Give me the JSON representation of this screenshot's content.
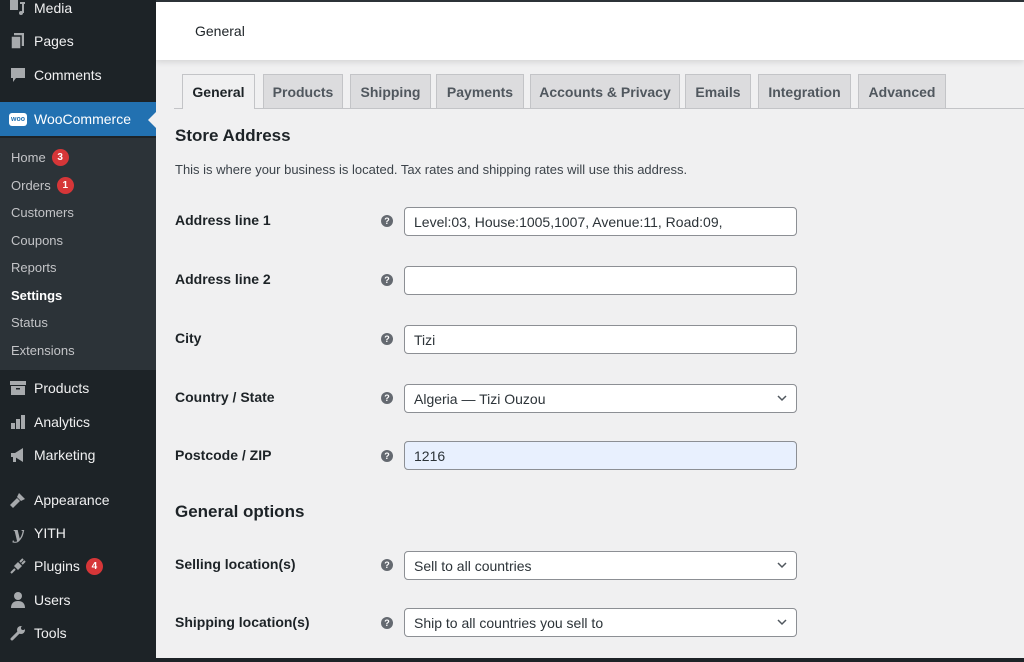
{
  "sidebar": {
    "top_items": [
      {
        "label": "Media",
        "icon": "media-icon"
      },
      {
        "label": "Pages",
        "icon": "pages-icon"
      },
      {
        "label": "Comments",
        "icon": "comments-icon"
      }
    ],
    "woocommerce": {
      "label": "WooCommerce",
      "icon": "woo-icon",
      "icon_text": "woo"
    },
    "submenu": [
      {
        "label": "Home",
        "badge": "3"
      },
      {
        "label": "Orders",
        "badge": "1"
      },
      {
        "label": "Customers"
      },
      {
        "label": "Coupons"
      },
      {
        "label": "Reports"
      },
      {
        "label": "Settings",
        "current": true
      },
      {
        "label": "Status"
      },
      {
        "label": "Extensions"
      }
    ],
    "bottom_items": [
      {
        "label": "Products",
        "icon": "archive-icon"
      },
      {
        "label": "Analytics",
        "icon": "bar-chart-icon"
      },
      {
        "label": "Marketing",
        "icon": "megaphone-icon"
      },
      {
        "label": "Appearance",
        "icon": "paintbrush-icon"
      },
      {
        "label": "YITH",
        "icon": "yith-icon",
        "icon_text": "y"
      },
      {
        "label": "Plugins",
        "icon": "plug-icon",
        "badge": "4"
      },
      {
        "label": "Users",
        "icon": "user-icon"
      },
      {
        "label": "Tools",
        "icon": "wrench-icon"
      }
    ],
    "colors": {
      "background": "#1d2327",
      "submenu_bg": "#2c3338",
      "active": "#2271b1",
      "badge": "#d63638"
    }
  },
  "header": {
    "title": "General"
  },
  "tabs": [
    {
      "label": "General",
      "active": true
    },
    {
      "label": "Products"
    },
    {
      "label": "Shipping"
    },
    {
      "label": "Payments"
    },
    {
      "label": "Accounts & Privacy"
    },
    {
      "label": "Emails"
    },
    {
      "label": "Integration"
    },
    {
      "label": "Advanced"
    }
  ],
  "store_address": {
    "heading": "Store Address",
    "description": "This is where your business is located. Tax rates and shipping rates will use this address.",
    "fields": [
      {
        "label": "Address line 1",
        "value": "Level:03, House:1005,1007, Avenue:11, Road:09,",
        "type": "text"
      },
      {
        "label": "Address line 2",
        "value": "",
        "type": "text"
      },
      {
        "label": "City",
        "value": "Tizi",
        "type": "text"
      },
      {
        "label": "Country / State",
        "value": "Algeria — Tizi Ouzou",
        "type": "select"
      },
      {
        "label": "Postcode / ZIP",
        "value": "1216",
        "type": "text",
        "focused": true
      }
    ]
  },
  "general_options": {
    "heading": "General options",
    "fields": [
      {
        "label": "Selling location(s)",
        "value": "Sell to all countries",
        "type": "select"
      },
      {
        "label": "Shipping location(s)",
        "value": "Ship to all countries you sell to",
        "type": "select"
      }
    ]
  },
  "help_icon_glyph": "?"
}
